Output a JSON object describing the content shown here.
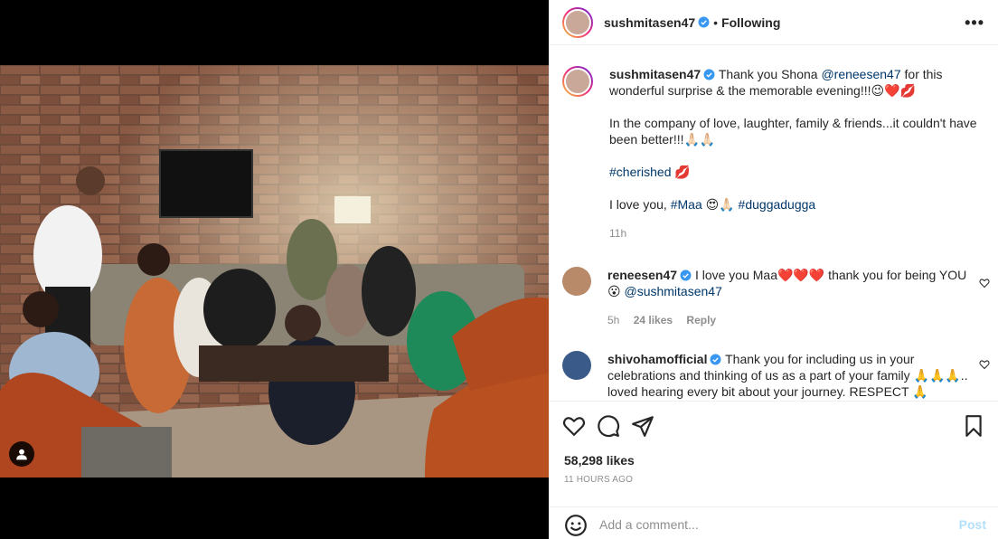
{
  "colors": {
    "link": "#00376b",
    "verified": "#3897f0",
    "muted": "#8e8e8e",
    "post_disabled": "#b2dffc"
  },
  "header": {
    "username": "sushmitasen47",
    "separator": "•",
    "follow_status": "Following",
    "more": "•••"
  },
  "caption": {
    "username": "sushmitasen47",
    "line1_pre": "Thank you Shona ",
    "mention": "@reneesen47",
    "line1_post": " for this wonderful surprise & the memorable evening!!!😉❤️💋",
    "para2": "In the company of love, laughter, family & friends...it couldn't have been better!!!🙏🏻🙏🏻",
    "hashtag1": "#cherished",
    "hashtag1_emoji": " 💋",
    "para4_pre": "I love you, ",
    "hashtag2": "#Maa",
    "para4_mid": " 😍🙏🏻 ",
    "hashtag3": "#duggadugga",
    "time": "11h"
  },
  "comments": [
    {
      "username": "reneesen47",
      "text": " I love you Maa❤️❤️❤️ thank you for being YOU 😮 ",
      "mention": "@sushmitasen47",
      "time": "5h",
      "likes": "24 likes",
      "reply": "Reply"
    },
    {
      "username": "shivohamofficial",
      "text": " Thank you for including us in your celebrations and thinking of us as a part of your family 🙏🙏🙏.. loved hearing every bit about your journey. RESPECT 🙏"
    }
  ],
  "actions": {
    "likes": "58,298 likes",
    "posted": "11 HOURS AGO"
  },
  "add_comment": {
    "placeholder": "Add a comment...",
    "post": "Post"
  },
  "icons": [
    "heart-icon",
    "comment-icon",
    "share-icon",
    "bookmark-icon",
    "emoji-icon",
    "tag-user-icon",
    "more-options-icon",
    "verified-icon"
  ]
}
